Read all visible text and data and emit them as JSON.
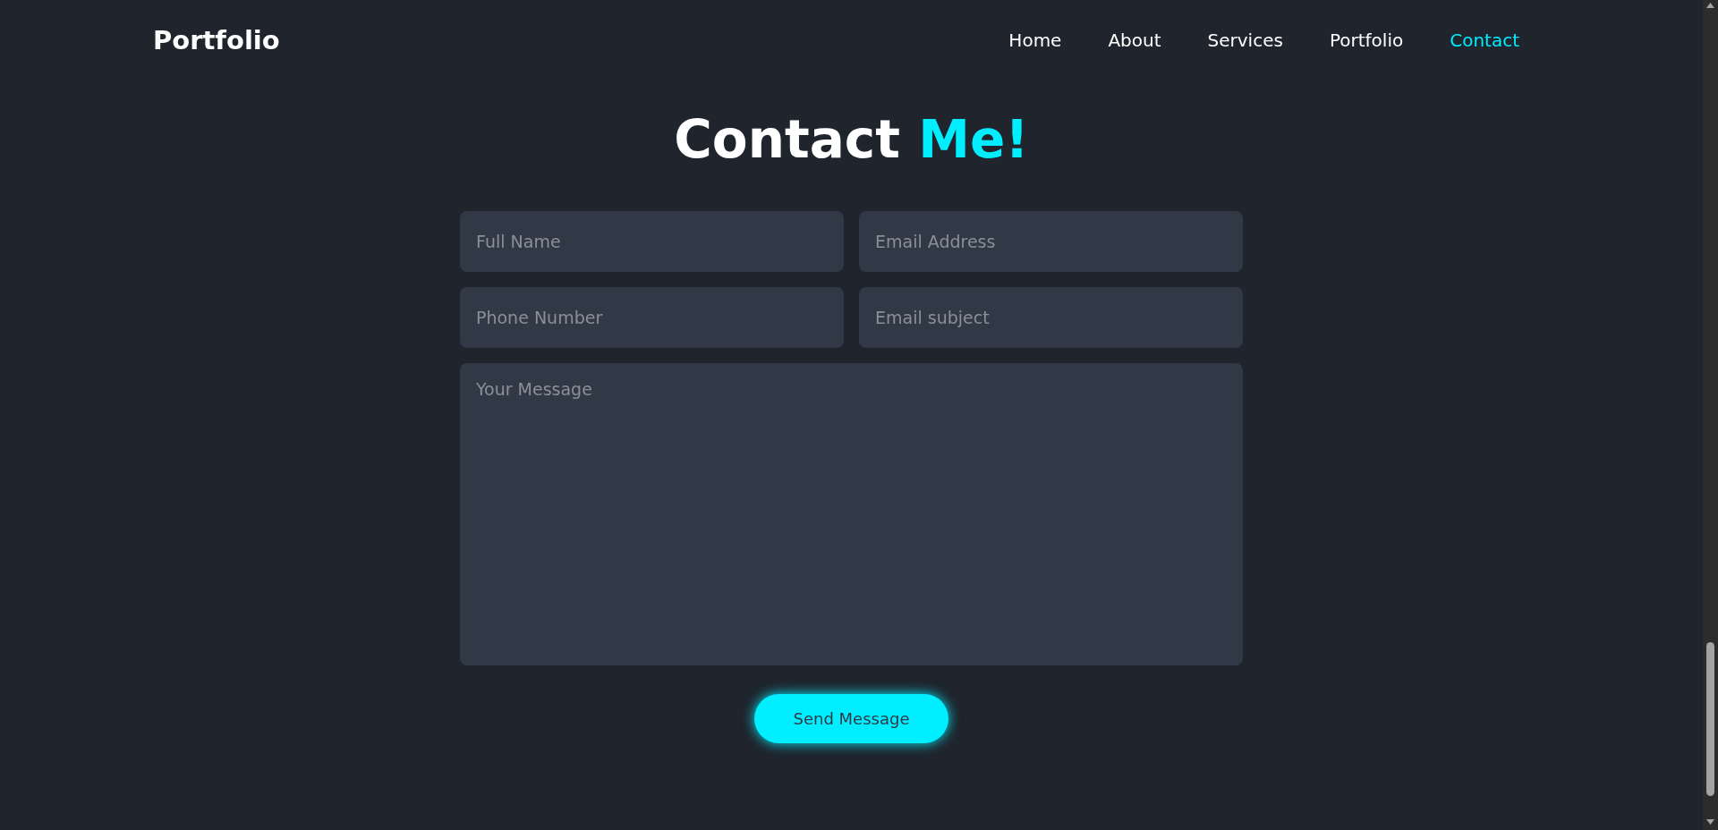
{
  "header": {
    "logo": "Portfolio",
    "nav": [
      {
        "label": "Home",
        "selected": false
      },
      {
        "label": "About",
        "selected": false
      },
      {
        "label": "Services",
        "selected": false
      },
      {
        "label": "Portfolio",
        "selected": false
      },
      {
        "label": "Contact",
        "selected": true
      }
    ]
  },
  "contact": {
    "title": "Contact",
    "title_accent": "Me!",
    "fields": [
      {
        "placeholder": "Full Name",
        "kind": "input"
      },
      {
        "placeholder": "Email Address",
        "kind": "input"
      },
      {
        "placeholder": "Phone Number",
        "kind": "input"
      },
      {
        "placeholder": "Email subject",
        "kind": "input"
      },
      {
        "placeholder": "Your Message",
        "kind": "textarea"
      }
    ],
    "submit": "Send Message"
  }
}
